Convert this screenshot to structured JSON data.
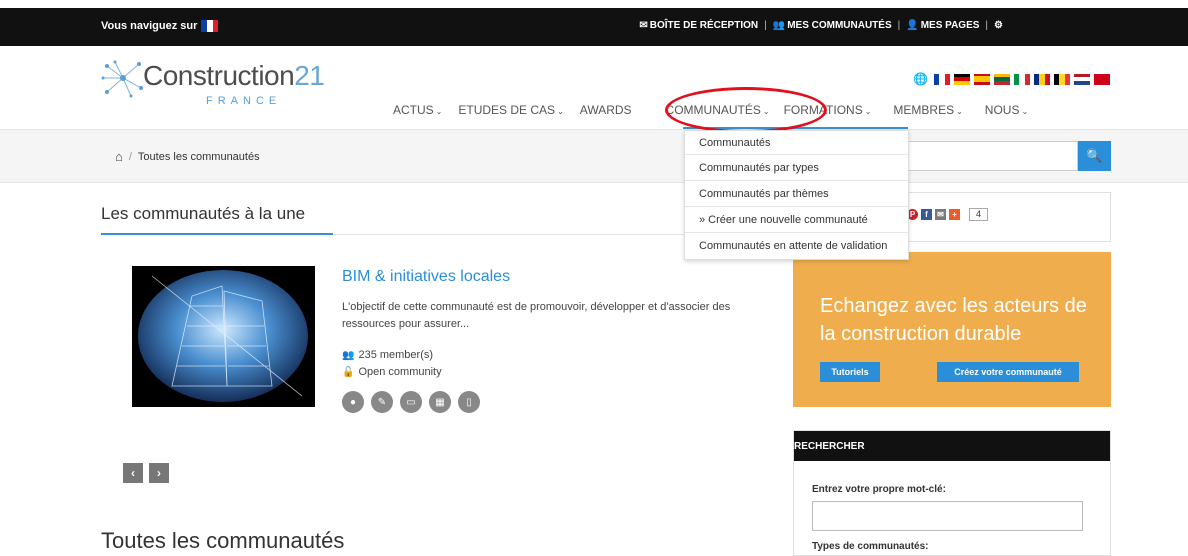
{
  "topbar": {
    "navigating_label": "Vous naviguez sur",
    "inbox": "BOÎTE DE RÉCEPTION",
    "my_communities": "MES COMMUNAUTÉS",
    "my_pages": "MES PAGES"
  },
  "logo": {
    "name": "Construction",
    "number": "21",
    "sub": "FRANCE"
  },
  "nav": {
    "items": [
      {
        "label": "ACTUS",
        "dropdown": true
      },
      {
        "label": "ETUDES DE CAS",
        "dropdown": true
      },
      {
        "label": "AWARDS",
        "dropdown": false
      },
      {
        "label": "COMMUNAUTÉS",
        "dropdown": true
      },
      {
        "label": "FORMATIONS",
        "dropdown": true
      },
      {
        "label": "MEMBRES",
        "dropdown": true
      },
      {
        "label": "NOUS",
        "dropdown": true
      }
    ]
  },
  "breadcrumb": {
    "current": "Toutes les communautés"
  },
  "dropdown": {
    "items": [
      "Communautés",
      "Communautés par types",
      "Communautés par thèmes",
      "» Créer une nouvelle communauté",
      "Communautés en attente de validation"
    ]
  },
  "featured": {
    "section_title": "Les communautés à la une",
    "card": {
      "title": "BIM & initiatives locales",
      "description": "L'objectif de cette communauté est de promouvoir, développer et d'associer des ressources pour assurer...",
      "members": "235 member(s)",
      "access": "Open community"
    }
  },
  "all_communities_title": "Toutes les communautés",
  "share": {
    "count": "4"
  },
  "promo": {
    "text": "Echangez avec les acteurs de la construction durable",
    "tutorials": "Tutoriels",
    "create": "Créez votre communauté"
  },
  "search_panel": {
    "header": "RECHERCHER",
    "keyword_label": "Entrez votre propre mot-clé:",
    "types_label": "Types de communautés:"
  },
  "colors": {
    "accent_blue": "#2a8fd8",
    "promo_orange": "#f0ad4e",
    "highlight_red": "#e0101e"
  }
}
